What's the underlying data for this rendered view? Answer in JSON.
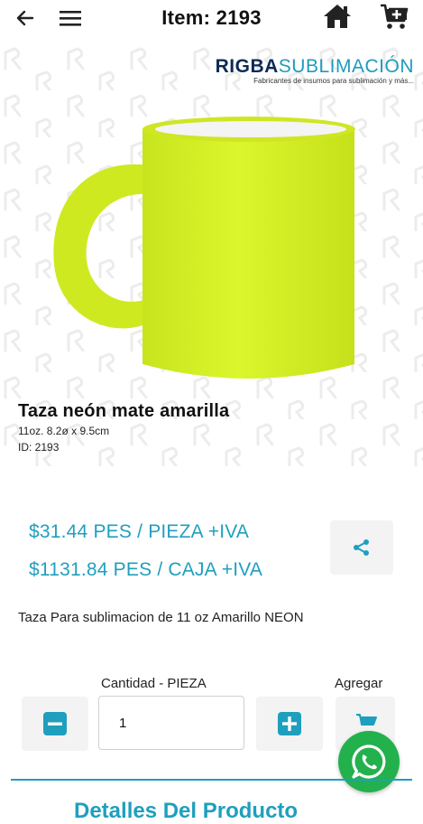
{
  "header": {
    "title": "Item: 2193",
    "icons": [
      "back-arrow-icon",
      "hamburger-menu-icon",
      "home-icon",
      "add-to-cart-icon"
    ]
  },
  "brand": {
    "name_r": "R",
    "name_rest": "IGBA",
    "name_suffix": "SUBLIMACIÓN",
    "tagline": "Fabricantes de insumos para sublimación y más..."
  },
  "product": {
    "name": "Taza neón mate amarilla",
    "specs": "11oz. 8.2ø x 9.5cm",
    "id": "ID: 2193",
    "mug_color": "#d9f52a",
    "price_piece": "$31.44 PES / PIEZA +IVA",
    "price_box": "$1131.84 PES / CAJA +IVA",
    "description": "Taza Para sublimacion de 11 oz Amarillo NEON"
  },
  "quantity": {
    "label": "Cantidad - PIEZA",
    "value": "1",
    "add_label": "Agregar"
  },
  "details_heading": "Detalles Del Producto",
  "colors": {
    "accent": "#1f9fbe",
    "brand_dark": "#0c2b57",
    "whatsapp": "#22b14c"
  }
}
